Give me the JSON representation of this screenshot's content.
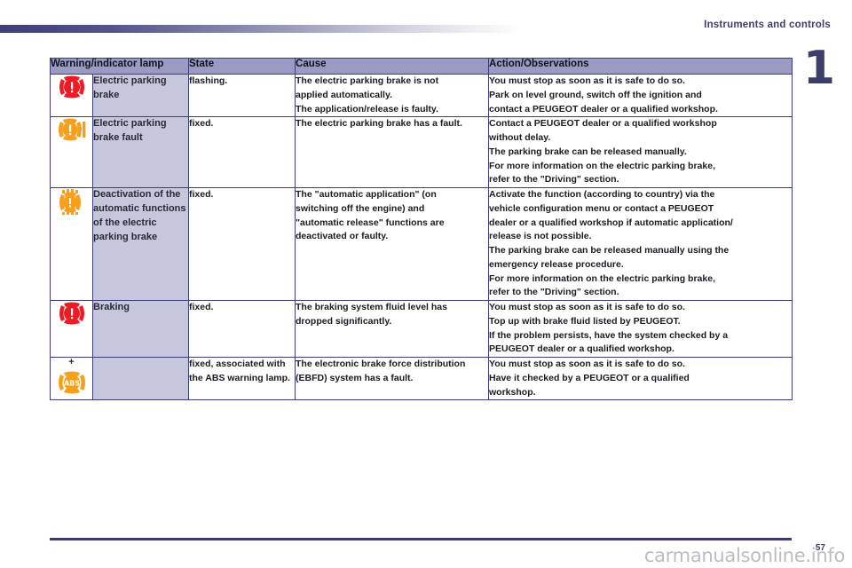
{
  "header": {
    "running_title": "Instruments and controls",
    "chapter_number": "1"
  },
  "colors": {
    "accent_purple": "#3d3d6b",
    "header_row": "#9a9ac4",
    "lamp_column": "#c6c6dd",
    "warning_red": "#ed1c24",
    "warning_amber": "#f8a01b"
  },
  "table": {
    "columns": [
      "Warning/indicator lamp",
      "State",
      "Cause",
      "Action/Observations"
    ],
    "rows": [
      {
        "icon": "parking-brake-red-icon",
        "icon_color": "#ed1c24",
        "icon_plus": "",
        "lamp": "Electric parking brake",
        "state": "flashing.",
        "cause": [
          "The electric parking brake is not",
          "applied automatically.",
          "The application/release is faulty."
        ],
        "action": [
          "You must stop as soon as it is safe to do so.",
          "Park on level ground, switch off the ignition and",
          "contact a PEUGEOT dealer or a qualified workshop."
        ]
      },
      {
        "icon": "parking-brake-fault-amber-icon",
        "icon_color": "#f8a01b",
        "icon_plus": "",
        "lamp": "Electric parking brake fault",
        "state": "fixed.",
        "cause": [
          "The electric parking brake has a fault."
        ],
        "action": [
          "Contact a PEUGEOT dealer or a qualified workshop",
          "without delay.",
          "The parking brake can be released manually.",
          "For more information on the electric parking brake,",
          "refer to the \"Driving\" section."
        ]
      },
      {
        "icon": "parking-brake-auto-deactivated-amber-icon",
        "icon_color": "#f8a01b",
        "icon_plus": "",
        "lamp": "Deactivation of the automatic functions of the electric parking brake",
        "state": "fixed.",
        "cause": [
          "The \"automatic application\" (on",
          "switching off the engine) and",
          "\"automatic release\" functions are",
          "deactivated or faulty."
        ],
        "action": [
          "Activate the function (according to country) via the",
          "vehicle configuration menu or contact a PEUGEOT",
          "dealer or a qualified workshop if automatic application/",
          "release is not possible.",
          "The parking brake can be released manually using the",
          "emergency release procedure.",
          "For more information on the electric parking brake,",
          "refer to the \"Driving\" section."
        ]
      },
      {
        "icon": "braking-red-icon",
        "icon_color": "#ed1c24",
        "icon_plus": "",
        "lamp": "Braking",
        "state": "fixed.",
        "cause": [
          "The braking system fluid level has",
          "dropped significantly."
        ],
        "action": [
          "You must stop as soon as it is safe to do so.",
          "Top up with brake fluid listed by PEUGEOT.",
          "If the problem persists, have the system checked by a",
          "PEUGEOT dealer or a qualified workshop."
        ]
      },
      {
        "icon": "abs-amber-icon",
        "icon_color": "#f8a01b",
        "icon_plus": "+",
        "lamp": "",
        "state": "fixed, associated with the ABS warning lamp.",
        "cause": [
          "The electronic brake force distribution",
          "(EBFD) system has a fault."
        ],
        "action": [
          "You must stop as soon as it is safe to do so.",
          "Have it checked by a PEUGEOT or a qualified",
          "workshop."
        ]
      }
    ]
  },
  "footer": {
    "page_number": "57",
    "watermark": "carmanualsonline.info"
  }
}
